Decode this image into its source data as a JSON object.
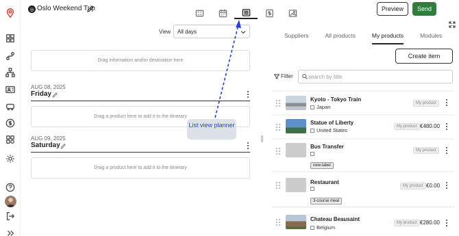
{
  "header": {
    "trip_title": "Oslo Weekend Trip",
    "preview_label": "Preview",
    "send_label": "Send"
  },
  "view_tabs": [
    "grid-view",
    "calendar-view",
    "list-view",
    "price-view",
    "image-view"
  ],
  "planner": {
    "view_label": "View",
    "view_value": "All days",
    "top_dropzone": "Drag information and/or destination here",
    "days": [
      {
        "date": "AUG 08, 2025",
        "name": "Friday",
        "dropzone": "Drag a product here to add it to the itinerary"
      },
      {
        "date": "AUG 09, 2025",
        "name": "Saturday",
        "dropzone": "Drag a product here to add it to the itinerary"
      }
    ]
  },
  "annotation": {
    "text": "List view planner",
    "color": "#2a3fd0"
  },
  "products_panel": {
    "tabs": [
      "Suppliers",
      "All products",
      "My products",
      "Modules"
    ],
    "active_tab": "My products",
    "create_label": "Create item",
    "filter_label": "Filter",
    "search_placeholder": "search by title",
    "items": [
      {
        "name": "Kyoto - Tokyo Train",
        "location": "Japan",
        "badge": "My product",
        "price": "",
        "tag": ""
      },
      {
        "name": "Statue of Liberty",
        "location": "United States",
        "badge": "My product",
        "price": "€480.00",
        "tag": ""
      },
      {
        "name": "Bus Transfer",
        "location": "",
        "badge": "My product",
        "price": "",
        "tag": "new-label"
      },
      {
        "name": "Restaurant",
        "location": "",
        "badge": "My product",
        "price": "€0.00",
        "tag": "3-course meal"
      },
      {
        "name": "Chateau Beausaint",
        "location": "Belgium",
        "badge": "My product",
        "price": "€280.00",
        "tag": ""
      }
    ]
  },
  "colors": {
    "accent_green": "#2f7d3f",
    "brand_red": "#d8342c",
    "annotation_blue": "#2a3fd0"
  }
}
